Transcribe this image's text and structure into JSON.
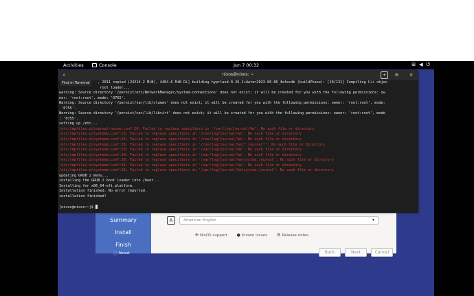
{
  "topbar": {
    "activities": "Activities",
    "app_name": "Console",
    "clock": "Jun 7  00:32",
    "tray_icons": [
      "network-icon",
      "volume-icon",
      "power-icon"
    ]
  },
  "installer": {
    "sidebar": {
      "summary": "Summary",
      "install": "Install",
      "finish": "Finish",
      "about": "About"
    },
    "language_value": "American English",
    "links": {
      "nix": "NixOS support",
      "issues": "Known issues",
      "notes": "Release notes"
    },
    "buttons": {
      "back": "Back",
      "next": "Next",
      "cancel": "Cancel"
    }
  },
  "terminal": {
    "title": "nixos@nixos: ~",
    "find_tooltip": "Find in Terminal",
    "lines": [
      {
        "text": "                  , 2011 copied (24214.2 MiB), 4484.6 MiB DL] building hyprland-0.26.1+date=2023-06-06_4afecdb (buildPhase): [10/131] Compiling C++ objec",
        "cls": ""
      },
      {
        "text": "                   root loader...",
        "cls": ""
      },
      {
        "text": "warning: Source directory '/persist/etc/NetworkManager/system-connections' does not exist; it will be created for you with the following permissions: ow",
        "cls": ""
      },
      {
        "text": "ner: 'root:root', mode: '0755'.",
        "cls": ""
      },
      {
        "text": "Warning: Source directory '/persist/var/lib/clamav' does not exist; it will be created for you with the following permissions: owner: 'root:root', mode:",
        "cls": ""
      },
      {
        "text": " '0755'.",
        "cls": ""
      },
      {
        "text": "Warning: Source directory '/persist/var/lib/libvirt' does not exist; it will be created for you with the following permissions: owner: 'root:root', mode",
        "cls": ""
      },
      {
        "text": ": '0755'.",
        "cls": ""
      },
      {
        "text": "setting up /etc...",
        "cls": ""
      },
      {
        "text": "/etc/tmpfiles.d/journal-nocow.conf:26: Failed to replace specifiers in '/var/log/journal/%m': No such file or directory",
        "cls": "red"
      },
      {
        "text": "/etc/tmpfiles.d/systemd.conf:23: Failed to replace specifiers in '/run/log/journal/%m': No such file or directory",
        "cls": "red"
      },
      {
        "text": "/etc/tmpfiles.d/systemd.conf:25: Failed to replace specifiers in '/run/log/journal/%m': No such file or directory",
        "cls": "red"
      },
      {
        "text": "/etc/tmpfiles.d/systemd.conf:26: Failed to replace specifiers in '/run/log/journal/%m/*.journal*': No such file or directory",
        "cls": "red"
      },
      {
        "text": "/etc/tmpfiles.d/systemd.conf:29: Failed to replace specifiers in '/var/log/journal/%m': No such file or directory",
        "cls": "red"
      },
      {
        "text": "/etc/tmpfiles.d/systemd.conf:30: Failed to replace specifiers in '/var/log/journal/%m': No such file or directory",
        "cls": "red"
      },
      {
        "text": "/etc/tmpfiles.d/systemd.conf:30: Failed to replace specifiers in '/var/log/journal/%m/system.journal': No such file or directory",
        "cls": "red"
      },
      {
        "text": "/etc/tmpfiles.d/systemd.conf:31: Failed to replace specifiers in '/var/log/journal/%m': No such file or directory",
        "cls": "red"
      },
      {
        "text": "/etc/tmpfiles.d/systemd.conf:31: Failed to replace specifiers in '/var/log/journal/%m/system.journal': No such file or directory",
        "cls": "red"
      },
      {
        "text": "updating GRUB 2 menu...",
        "cls": ""
      },
      {
        "text": "installing the GRUB 2 boot loader into /boot...",
        "cls": ""
      },
      {
        "text": "Installing for x86_64-efi platform.",
        "cls": ""
      },
      {
        "text": "Installation finished. No error reported.",
        "cls": ""
      },
      {
        "text": "installation finished!",
        "cls": ""
      },
      {
        "text": "",
        "cls": ""
      }
    ],
    "prompt": "[nixos@nixos:~]$ "
  }
}
